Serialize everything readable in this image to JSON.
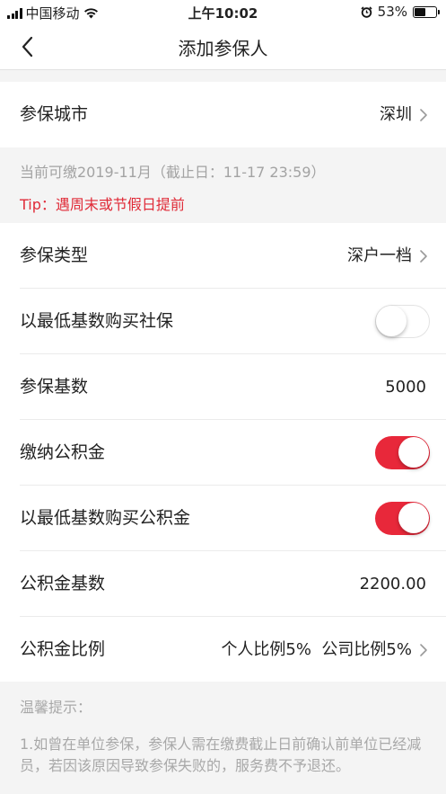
{
  "status_bar": {
    "carrier": "中国移动",
    "time": "上午10:02",
    "battery_percent": "53%",
    "battery_level": 0.53,
    "icons": [
      "signal-icon",
      "wifi-icon",
      "alarm-icon",
      "battery-icon"
    ]
  },
  "nav": {
    "title": "添加参保人",
    "back_icon": "chevron-left-icon"
  },
  "city_row": {
    "label": "参保城市",
    "value": "深圳"
  },
  "notice": {
    "deadline": "当前可缴2019-11月（截止日：11-17 23:59）",
    "tip": "Tip：遇周末或节假日提前"
  },
  "form": {
    "insurance_type": {
      "label": "参保类型",
      "value": "深户一档"
    },
    "min_base_social": {
      "label": "以最低基数购买社保",
      "on": false
    },
    "insurance_base": {
      "label": "参保基数",
      "value": "5000"
    },
    "housing_fund": {
      "label": "缴纳公积金",
      "on": true
    },
    "min_base_fund": {
      "label": "以最低基数购买公积金",
      "on": true
    },
    "fund_base": {
      "label": "公积金基数",
      "value": "2200.00"
    },
    "fund_ratio": {
      "label": "公积金比例",
      "value": "个人比例5%  公司比例5%"
    }
  },
  "tips": {
    "title": "温馨提示：",
    "body": "1.如曾在单位参保，参保人需在缴费截止日前确认前单位已经减员，若因该原因导致参保失败的，服务费不予退还。"
  },
  "colors": {
    "accent": "#e8283a",
    "tip_text": "#e02a37",
    "muted_text": "#a3a3a3",
    "background": "#f4f4f4"
  }
}
